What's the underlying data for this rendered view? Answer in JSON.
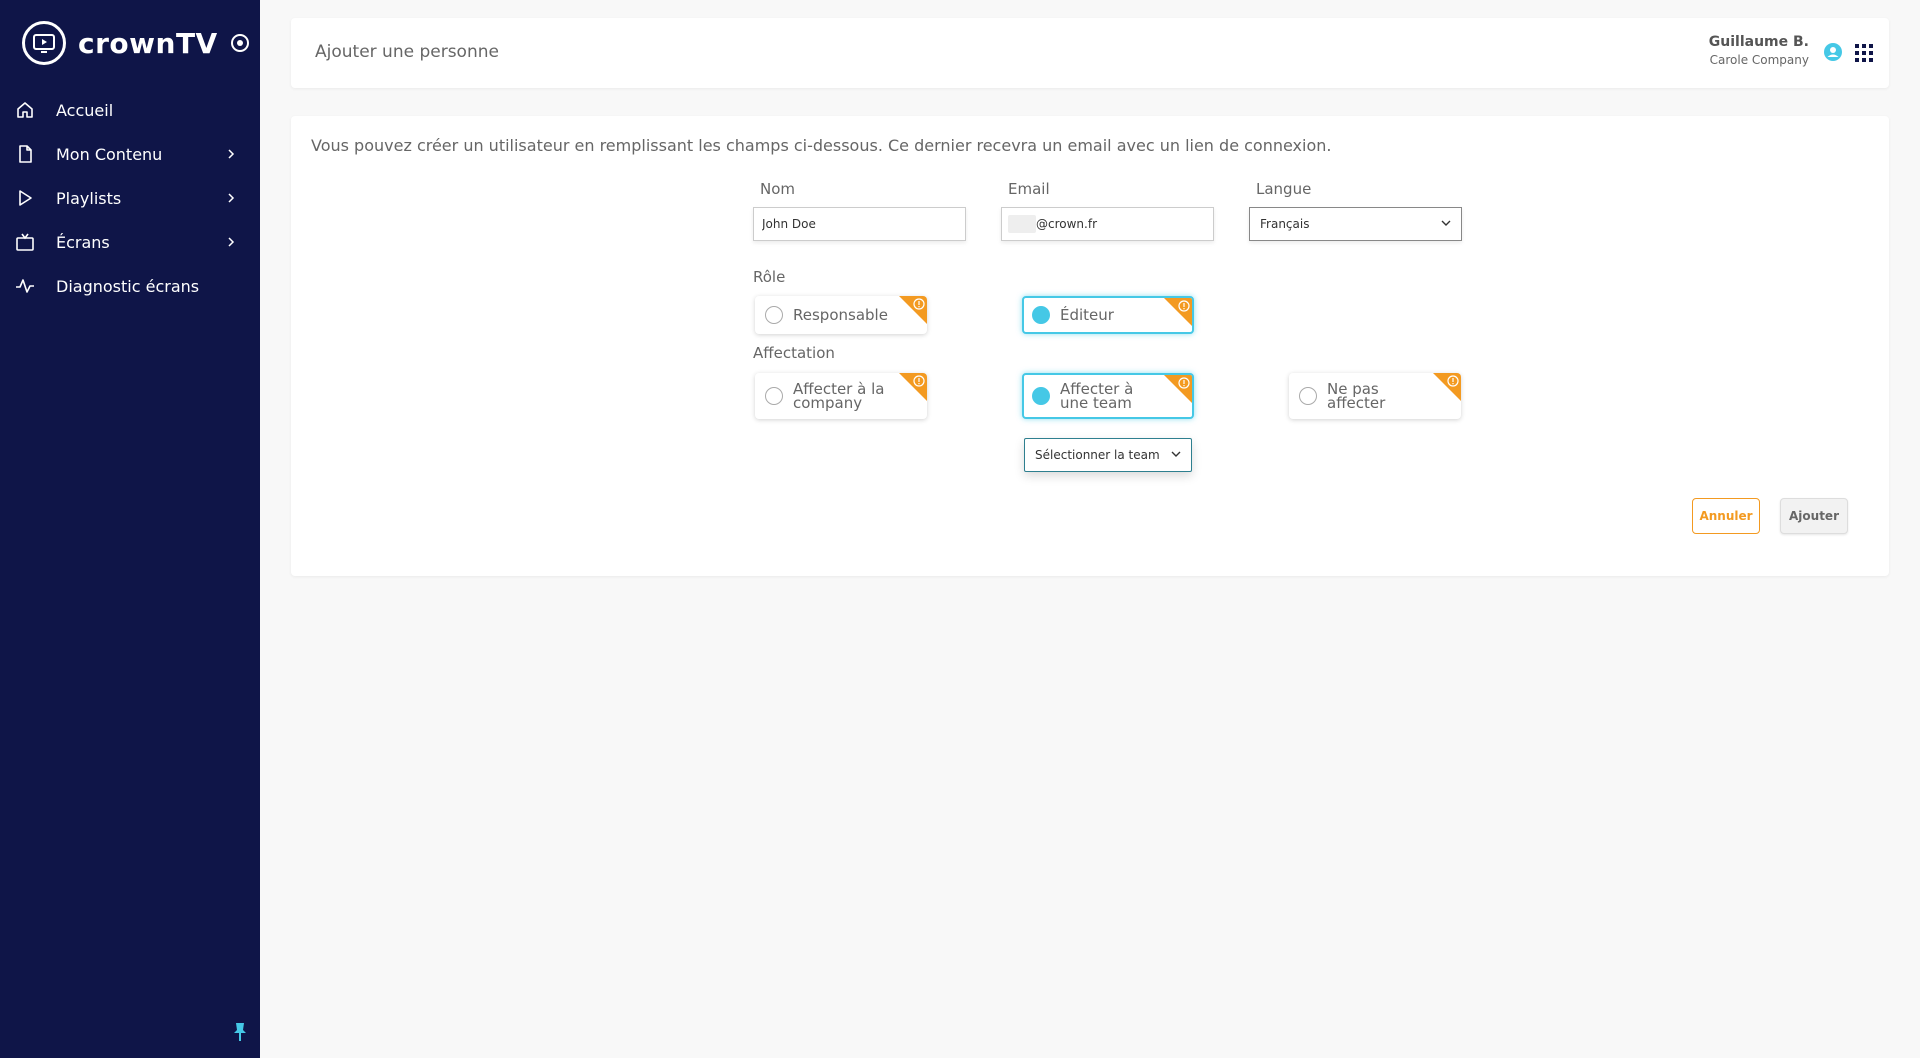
{
  "brand": {
    "name": "crownTV"
  },
  "sidebar": {
    "items": [
      {
        "label": "Accueil",
        "icon": "home-icon",
        "has_children": false
      },
      {
        "label": "Mon Contenu",
        "icon": "document-icon",
        "has_children": true
      },
      {
        "label": "Playlists",
        "icon": "play-icon",
        "has_children": true
      },
      {
        "label": "Écrans",
        "icon": "tv-icon",
        "has_children": true
      },
      {
        "label": "Diagnostic écrans",
        "icon": "activity-icon",
        "has_children": false
      }
    ]
  },
  "header": {
    "title": "Ajouter une personne",
    "user_name": "Guillaume B.",
    "company": "Carole Company"
  },
  "form": {
    "intro": "Vous pouvez créer un utilisateur en remplissant les champs ci-dessous. Ce dernier recevra un email avec un lien de connexion.",
    "name_label": "Nom",
    "name_value": "John Doe",
    "email_label": "Email",
    "email_domain": "@crown.fr",
    "language_label": "Langue",
    "language_value": "Français",
    "role_label": "Rôle",
    "roles": [
      {
        "label": "Responsable",
        "selected": false
      },
      {
        "label": "Éditeur",
        "selected": true
      }
    ],
    "assignment_label": "Affectation",
    "assignments": [
      {
        "line1": "Affecter à la",
        "line2": "company",
        "selected": false
      },
      {
        "line1": "Affecter à",
        "line2": "une team",
        "selected": true
      },
      {
        "line1": "Ne pas",
        "line2": "affecter",
        "selected": false
      }
    ],
    "team_select_value": "Sélectionner la team",
    "cancel_label": "Annuler",
    "add_label": "Ajouter"
  },
  "colors": {
    "sidebar_bg": "#0f1548",
    "accent": "#45c8e6",
    "warning": "#f39a21"
  }
}
